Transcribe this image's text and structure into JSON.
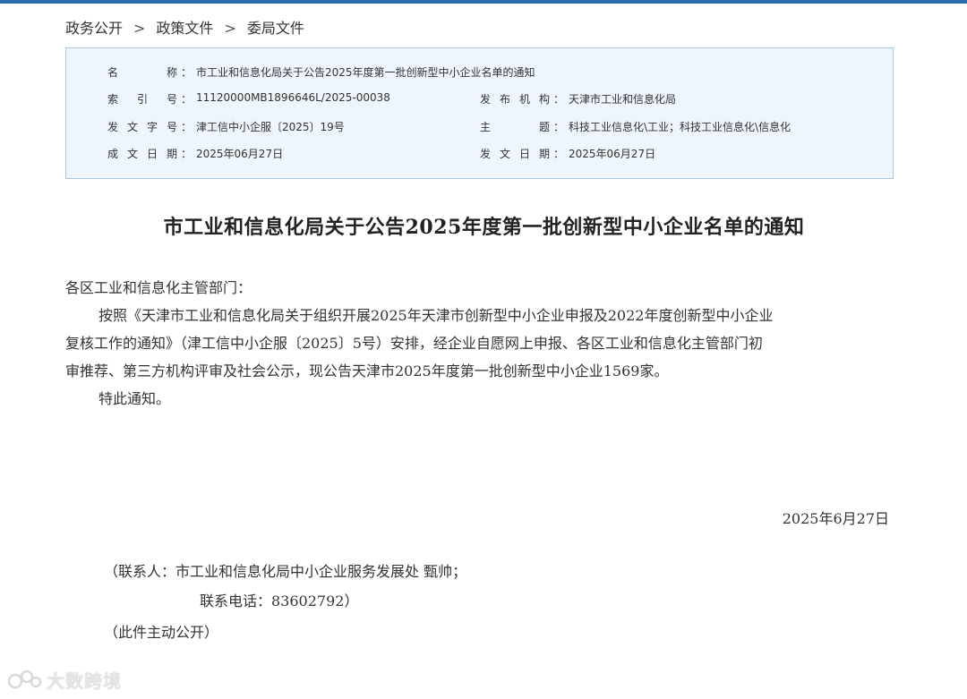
{
  "breadcrumb": {
    "items": [
      "政务公开",
      "政策文件",
      "委局文件"
    ],
    "separator": ">"
  },
  "meta": {
    "name_label": "名　　称",
    "name_value": "市工业和信息化局关于公告2025年度第一批创新型中小企业名单的通知",
    "index_label": "索 引 号",
    "index_value": "11120000MB1896646L/2025-00038",
    "publisher_label": "发布机构",
    "publisher_value": "天津市工业和信息化局",
    "docno_label": "发文字号",
    "docno_value": "津工信中小企服〔2025〕19号",
    "topic_label": "主　　题",
    "topic_value": "科技工业信息化\\工业；科技工业信息化\\信息化",
    "written_label": "成文日期",
    "written_value": "2025年06月27日",
    "issued_label": "发文日期",
    "issued_value": "2025年06月27日",
    "colon": "："
  },
  "document": {
    "title": "市工业和信息化局关于公告2025年度第一批创新型中小企业名单的通知",
    "salutation": "各区工业和信息化主管部门：",
    "para1_line1": "按照《天津市工业和信息化局关于组织开展2025年天津市创新型中小企业申报及2022年度创新型中小企业",
    "para1_line2": "复核工作的通知》（津工信中小企服〔2025〕5号）安排，经企业自愿网上申报、各区工业和信息化主管部门初",
    "para1_line3": "审推荐、第三方机构评审及社会公示，现公告天津市2025年度第一批创新型中小企业1569家。",
    "para2": "特此通知。",
    "date": "2025年6月27日",
    "contact_line1": "（联系人：市工业和信息化局中小企业服务发展处 甄帅；",
    "contact_line2": "联系电话：83602792）",
    "disclosure": "（此件主动公开）"
  },
  "watermark": {
    "text": "大数跨境"
  },
  "colors": {
    "accent": "#2a6db0",
    "meta_bg": "#eef5fc",
    "meta_border": "#a9c7e6"
  }
}
